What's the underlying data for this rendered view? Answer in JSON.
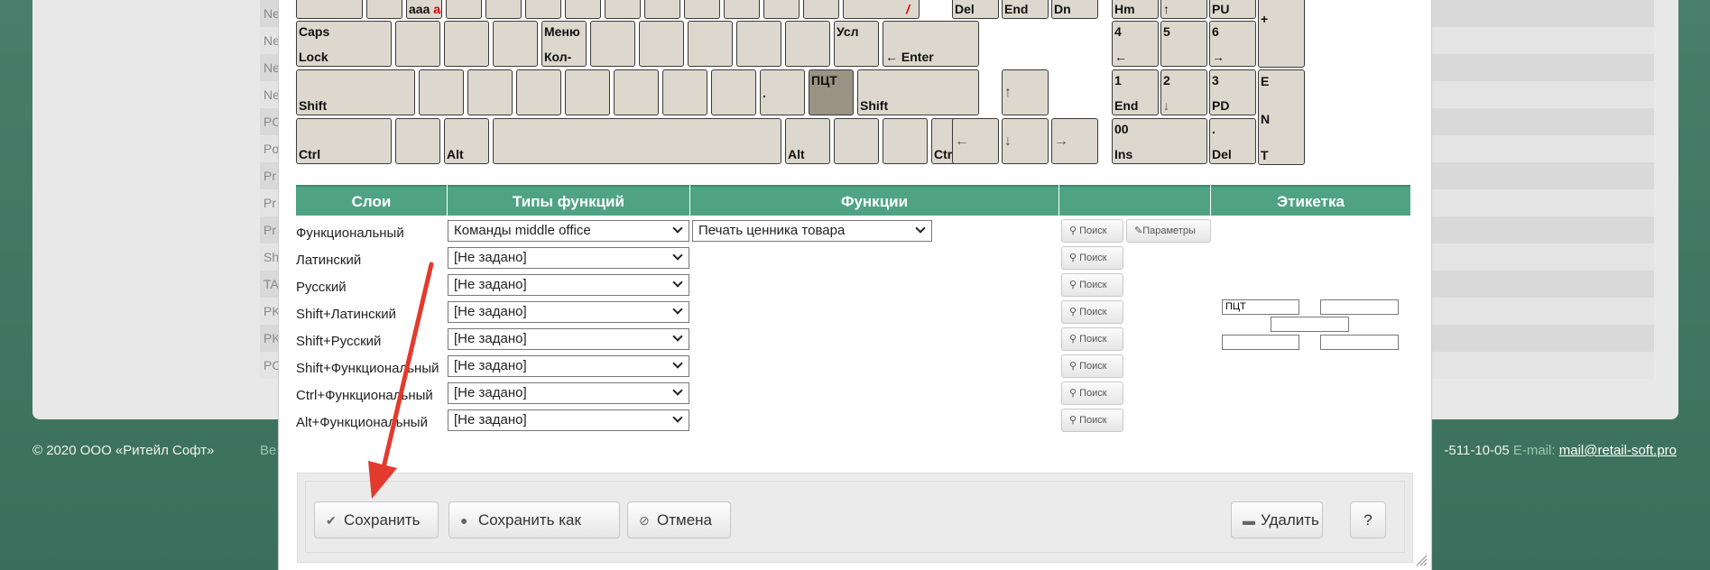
{
  "background": {
    "rows": [
      "Ne",
      "Ne",
      "Ne",
      "Ne",
      "PO",
      "Po",
      "Pr",
      "Pr",
      "Pr",
      "Sh",
      "TA",
      "PK",
      "PK",
      "PO"
    ],
    "footer": {
      "copyright": "© 2020 ООО «Ритейл Софт»",
      "mid_text": "Ве",
      "phone": "-511-10-05",
      "email_label": "E-mail:",
      "email": "mail@retail-soft.pro"
    }
  },
  "keyboard": {
    "row1": {
      "aaa": "aaa",
      "aa_red": "aa",
      "slash": "/",
      "del": "Del",
      "end": "End",
      "dn": "Dn",
      "hm": "Hm",
      "up": "↑",
      "pu": "PU",
      "plus": "+"
    },
    "caps_top": "Caps",
    "caps_bottom": "Lock",
    "menu_top": "Меню",
    "menu_bottom": "Кол-",
    "usl": "Усл",
    "enter": "← Enter",
    "num4": "4",
    "num4_b": "←",
    "num5": "5",
    "num6": "6",
    "num6_b": "→",
    "shift_l": "Shift",
    "dot": ".",
    "pct": "ПЦТ",
    "shift_r": "Shift",
    "arrow_up": "↑",
    "num1": "1",
    "num1_b": "End",
    "num2": "2",
    "num2_b": "↓",
    "num3": "3",
    "num3_b": "PD",
    "enter_e": "E",
    "enter_n": "N",
    "enter_t": "T",
    "ctrl_l": "Ctrl",
    "alt_l": "Alt",
    "alt_r": "Alt",
    "ctrl_r": "Ctrl",
    "arrow_left": "←",
    "arrow_down": "↓",
    "arrow_right": "→",
    "num00": "00",
    "num00_b": "Ins",
    "numdot": ".",
    "numdot_b": "Del"
  },
  "table": {
    "headers": [
      "Слои",
      "Типы функций",
      "Функции",
      "",
      "Этикетка"
    ],
    "rows": [
      {
        "layer": "Функциональный",
        "type": "Команды middle office",
        "func": "Печать ценника товара"
      },
      {
        "layer": "Латинский",
        "type": "[Не задано]"
      },
      {
        "layer": "Русский",
        "type": "[Не задано]"
      },
      {
        "layer": "Shift+Латинский",
        "type": "[Не задано]"
      },
      {
        "layer": "Shift+Русский",
        "type": "[Не задано]"
      },
      {
        "layer": "Shift+Функциональный",
        "type": "[Не задано]"
      },
      {
        "layer": "Ctrl+Функциональный",
        "type": "[Не задано]"
      },
      {
        "layer": "Alt+Функциональный",
        "type": "[Не задано]"
      }
    ],
    "search_label": "Поиск",
    "params_label": "Параметры",
    "label_value": "ПЦТ"
  },
  "actions": {
    "save": "Сохранить",
    "save_as": "Сохранить как",
    "cancel": "Отмена",
    "delete": "Удалить",
    "help": "?"
  },
  "colors": {
    "header_green": "#4fa384",
    "key_bg": "#dcd8cd",
    "key_active": "#9a9383",
    "arrow_red": "#e23b2e"
  }
}
